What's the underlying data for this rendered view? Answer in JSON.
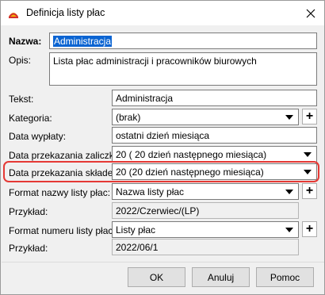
{
  "window": {
    "title": "Definicja listy płac"
  },
  "form": {
    "nazwa_label": "Nazwa:",
    "nazwa_value": "Administracja",
    "opis_label": "Opis:",
    "opis_value": "Lista płac administracji i pracowników biurowych",
    "tekst_label": "Tekst:",
    "tekst_value": "Administracja",
    "kategoria_label": "Kategoria:",
    "kategoria_value": "(brak)",
    "data_wyplaty_label": "Data wypłaty:",
    "data_wyplaty_value": "ostatni dzień miesiąca",
    "data_zaliczki_label": "Data przekazania zaliczki:",
    "data_zaliczki_value": "20 ( 20 dzień następnego miesiąca)",
    "data_skladek_label": "Data przekazania składek:",
    "data_skladek_value": "20 (20 dzień następnego miesiąca)",
    "format_nazwy_label": "Format nazwy listy płac:",
    "format_nazwy_value": "Nazwa listy płac",
    "przyklad1_label": "Przykład:",
    "przyklad1_value": "2022/Czerwiec/(LP)",
    "format_numeru_label": "Format numeru listy płac:",
    "format_numeru_value": "Listy płac",
    "przyklad2_label": "Przykład:",
    "przyklad2_value": "2022/06/1",
    "plus_symbol": "+"
  },
  "buttons": {
    "ok": "OK",
    "cancel": "Anuluj",
    "help": "Pomoc"
  },
  "colors": {
    "highlight": "#e53935",
    "selection": "#0a64d2"
  }
}
